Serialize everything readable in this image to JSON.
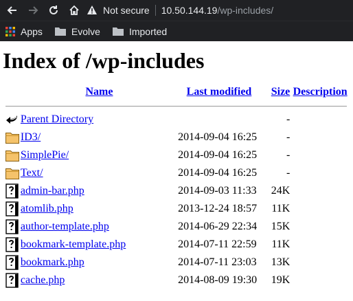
{
  "browser": {
    "security_label": "Not secure",
    "url_host": "10.50.144.19",
    "url_path": "/wp-includes/",
    "bookmarks": [
      {
        "label": "Apps",
        "icon": "apps-grid-icon"
      },
      {
        "label": "Evolve",
        "icon": "folder-icon"
      },
      {
        "label": "Imported",
        "icon": "folder-icon"
      }
    ]
  },
  "page": {
    "title": "Index of /wp-includes",
    "columns": {
      "name": "Name",
      "modified": "Last modified",
      "size": "Size",
      "description": "Description"
    },
    "rows": [
      {
        "icon": "back-icon",
        "name": "Parent Directory",
        "modified": "",
        "size": "-"
      },
      {
        "icon": "folder-icon",
        "name": "ID3/",
        "modified": "2014-09-04 16:25",
        "size": "-"
      },
      {
        "icon": "folder-icon",
        "name": "SimplePie/",
        "modified": "2014-09-04 16:25",
        "size": "-"
      },
      {
        "icon": "folder-icon",
        "name": "Text/",
        "modified": "2014-09-04 16:25",
        "size": "-"
      },
      {
        "icon": "unknown-file-icon",
        "name": "admin-bar.php",
        "modified": "2014-09-03 11:33",
        "size": "24K"
      },
      {
        "icon": "unknown-file-icon",
        "name": "atomlib.php",
        "modified": "2013-12-24 18:57",
        "size": "11K"
      },
      {
        "icon": "unknown-file-icon",
        "name": "author-template.php",
        "modified": "2014-06-29 22:34",
        "size": "15K"
      },
      {
        "icon": "unknown-file-icon",
        "name": "bookmark-template.php",
        "modified": "2014-07-11 22:59",
        "size": "11K"
      },
      {
        "icon": "unknown-file-icon",
        "name": "bookmark.php",
        "modified": "2014-07-11 23:03",
        "size": "13K"
      },
      {
        "icon": "unknown-file-icon",
        "name": "cache.php",
        "modified": "2014-08-09 19:30",
        "size": "19K"
      }
    ]
  }
}
